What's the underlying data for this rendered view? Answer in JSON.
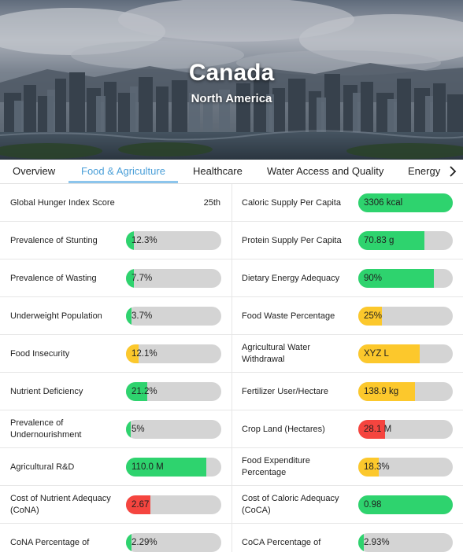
{
  "header": {
    "title": "Canada",
    "subtitle": "North America"
  },
  "colors": {
    "green": "#2ed36e",
    "yellow": "#fcc82c",
    "red": "#f5453f",
    "track": "#d4d4d4",
    "active_tab": "#4a9fd8"
  },
  "tabs": [
    {
      "label": "Overview",
      "active": false
    },
    {
      "label": "Food & Agriculture",
      "active": true
    },
    {
      "label": "Healthcare",
      "active": false
    },
    {
      "label": "Water Access and Quality",
      "active": false
    },
    {
      "label": "Energy",
      "active": false
    }
  ],
  "tab_next_icon": "chevron-right-icon",
  "left_metrics": [
    {
      "label": "Global Hunger Index Score",
      "rank": "25th"
    },
    {
      "label": "Prevalence of Stunting",
      "value": "12.3%",
      "level": 0.08,
      "color": "green"
    },
    {
      "label": "Prevalence of Wasting",
      "value": "7.7%",
      "level": 0.08,
      "color": "green"
    },
    {
      "label": "Underweight Population",
      "value": "3.7%",
      "level": 0.06,
      "color": "green"
    },
    {
      "label": "Food Insecurity",
      "value": "12.1%",
      "level": 0.13,
      "color": "yellow"
    },
    {
      "label": "Nutrient Deficiency",
      "value": "21.2%",
      "level": 0.22,
      "color": "green"
    },
    {
      "label": "Prevalence of Undernourishment",
      "value": "5%",
      "level": 0.05,
      "color": "green"
    },
    {
      "label": "Agricultural R&D",
      "value": "110.0 M",
      "level": 0.84,
      "color": "green"
    },
    {
      "label": "Cost of Nutrient Adequacy (CoNA)",
      "value": "2.67",
      "level": 0.26,
      "color": "red"
    },
    {
      "label": "CoNA Percentage of",
      "value": "2.29%",
      "level": 0.06,
      "color": "green"
    }
  ],
  "right_metrics": [
    {
      "label": "Caloric Supply Per Capita",
      "value": "3306 kcal",
      "level": 1.0,
      "color": "green"
    },
    {
      "label": "Protein Supply Per Capita",
      "value": "70.83 g",
      "level": 0.7,
      "color": "green"
    },
    {
      "label": "Dietary Energy Adequacy",
      "value": "90%",
      "level": 0.8,
      "color": "green"
    },
    {
      "label": "Food Waste Percentage",
      "value": "25%",
      "level": 0.25,
      "color": "yellow"
    },
    {
      "label": "Agricultural Water Withdrawal",
      "value": "XYZ L",
      "level": 0.65,
      "color": "yellow"
    },
    {
      "label": "Fertilizer User/Hectare",
      "value": "138.9 kg",
      "level": 0.6,
      "color": "yellow"
    },
    {
      "label": "Crop Land (Hectares)",
      "value": "28.1 M",
      "level": 0.28,
      "color": "red"
    },
    {
      "label": "Food Expenditure Percentage",
      "value": "18.3%",
      "level": 0.22,
      "color": "yellow"
    },
    {
      "label": "Cost of Caloric Adequacy (CoCA)",
      "value": "0.98",
      "level": 1.0,
      "color": "green"
    },
    {
      "label": "CoCA Percentage of",
      "value": "2.93%",
      "level": 0.06,
      "color": "green"
    }
  ]
}
